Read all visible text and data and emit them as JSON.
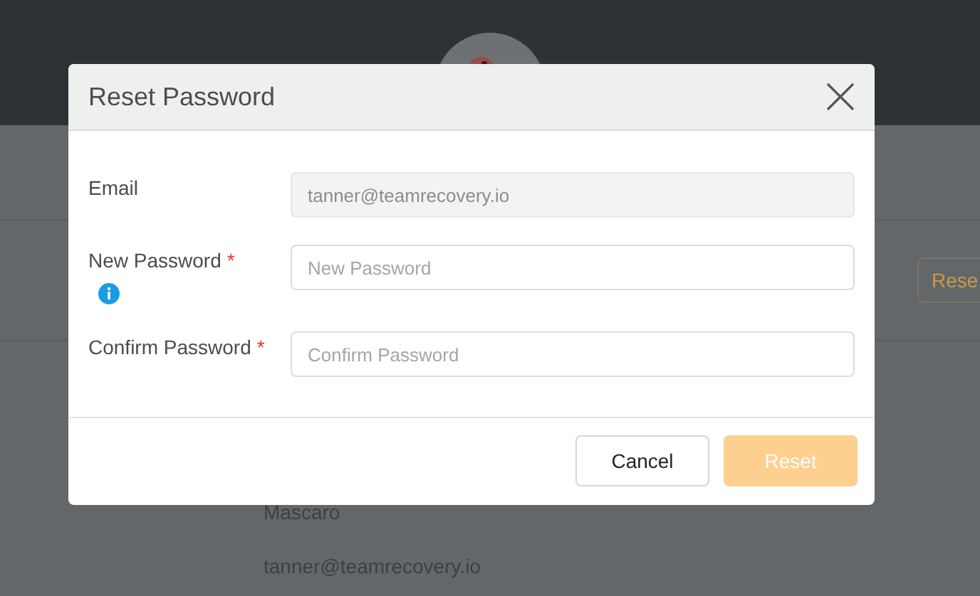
{
  "background": {
    "side_button": "Rese",
    "details": [
      "Mascaro",
      "tanner@teamrecovery.io"
    ]
  },
  "dialog": {
    "title": "Reset Password",
    "fields": [
      {
        "label": "Email",
        "info": false,
        "value": "tanner@teamrecovery.io",
        "disabled": true
      },
      {
        "label": "New Password",
        "required_mark": "*",
        "info": true,
        "placeholder": "New Password",
        "disabled": false
      },
      {
        "label": "Confirm Password",
        "required_mark": "*",
        "info": false,
        "placeholder": "Confirm Password",
        "disabled": false
      }
    ],
    "buttons": [
      {
        "label": "Cancel",
        "kind": "secondary",
        "disabled": false
      },
      {
        "label": "Reset",
        "kind": "primary",
        "disabled": true
      }
    ]
  }
}
